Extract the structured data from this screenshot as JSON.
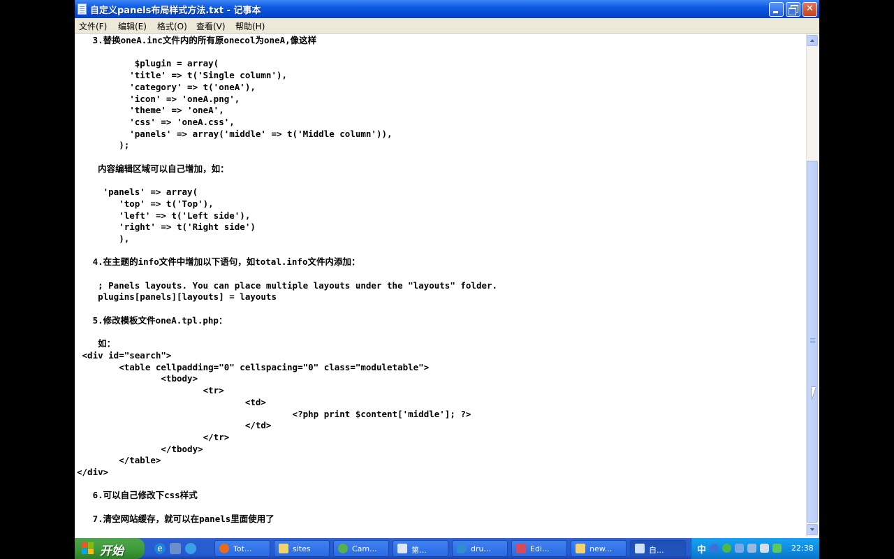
{
  "window": {
    "title": "自定义panels布局样式方法.txt - 记事本"
  },
  "menu": {
    "file": "文件(F)",
    "edit": "编辑(E)",
    "format": "格式(O)",
    "view": "查看(V)",
    "help": "帮助(H)"
  },
  "document": {
    "content": "   3.替换oneA.inc文件内的所有原onecol为oneA,像这样\n\n           $plugin = array(\n          'title' => t('Single column'),\n          'category' => t('oneA'),\n          'icon' => 'oneA.png',\n          'theme' => 'oneA',\n          'css' => 'oneA.css',\n          'panels' => array('middle' => t('Middle column')),\n        );\n\n    内容编辑区域可以自己增加，如：\n\n     'panels' => array(\n        'top' => t('Top'),\n        'left' => t('Left side'),\n        'right' => t('Right side')\n        ),\n\n   4.在主题的info文件中增加以下语句，如total.info文件内添加：\n\n    ; Panels layouts. You can place multiple layouts under the \"layouts\" folder.\n    plugins[panels][layouts] = layouts\n\n   5.修改模板文件oneA.tpl.php：\n\n    如：\n <div id=\"search\">\n        <table cellpadding=\"0\" cellspacing=\"0\" class=\"moduletable\">\n                <tbody>\n                        <tr>\n                                <td>\n                                         <?php print $content['middle']; ?>\n                                </td>\n                        </tr>\n                </tbody>\n        </table>\n</div>\n\n   6.可以自己修改下css样式\n\n   7.清空网站缓存，就可以在panels里面使用了"
  },
  "taskbar": {
    "start_label": "开始",
    "buttons": [
      {
        "label": "Tot...",
        "icon": "firefox-icon"
      },
      {
        "label": "sites",
        "icon": "folder-icon"
      },
      {
        "label": "Cam...",
        "icon": "camtasia-icon"
      },
      {
        "label": "第...",
        "icon": "word-doc-icon"
      },
      {
        "label": "dru...",
        "icon": "drupal-icon"
      },
      {
        "label": "Edi...",
        "icon": "editplus-icon"
      },
      {
        "label": "new...",
        "icon": "folder-icon"
      },
      {
        "label": "自...",
        "icon": "notepad-icon"
      }
    ],
    "ime_label": "中",
    "clock": "22:38"
  },
  "colors": {
    "titlebar": "#0a52d9",
    "menubar": "#ece9d8",
    "taskbar": "#245bd3",
    "start_button": "#3b9a38",
    "tray": "#0f8ae0"
  }
}
